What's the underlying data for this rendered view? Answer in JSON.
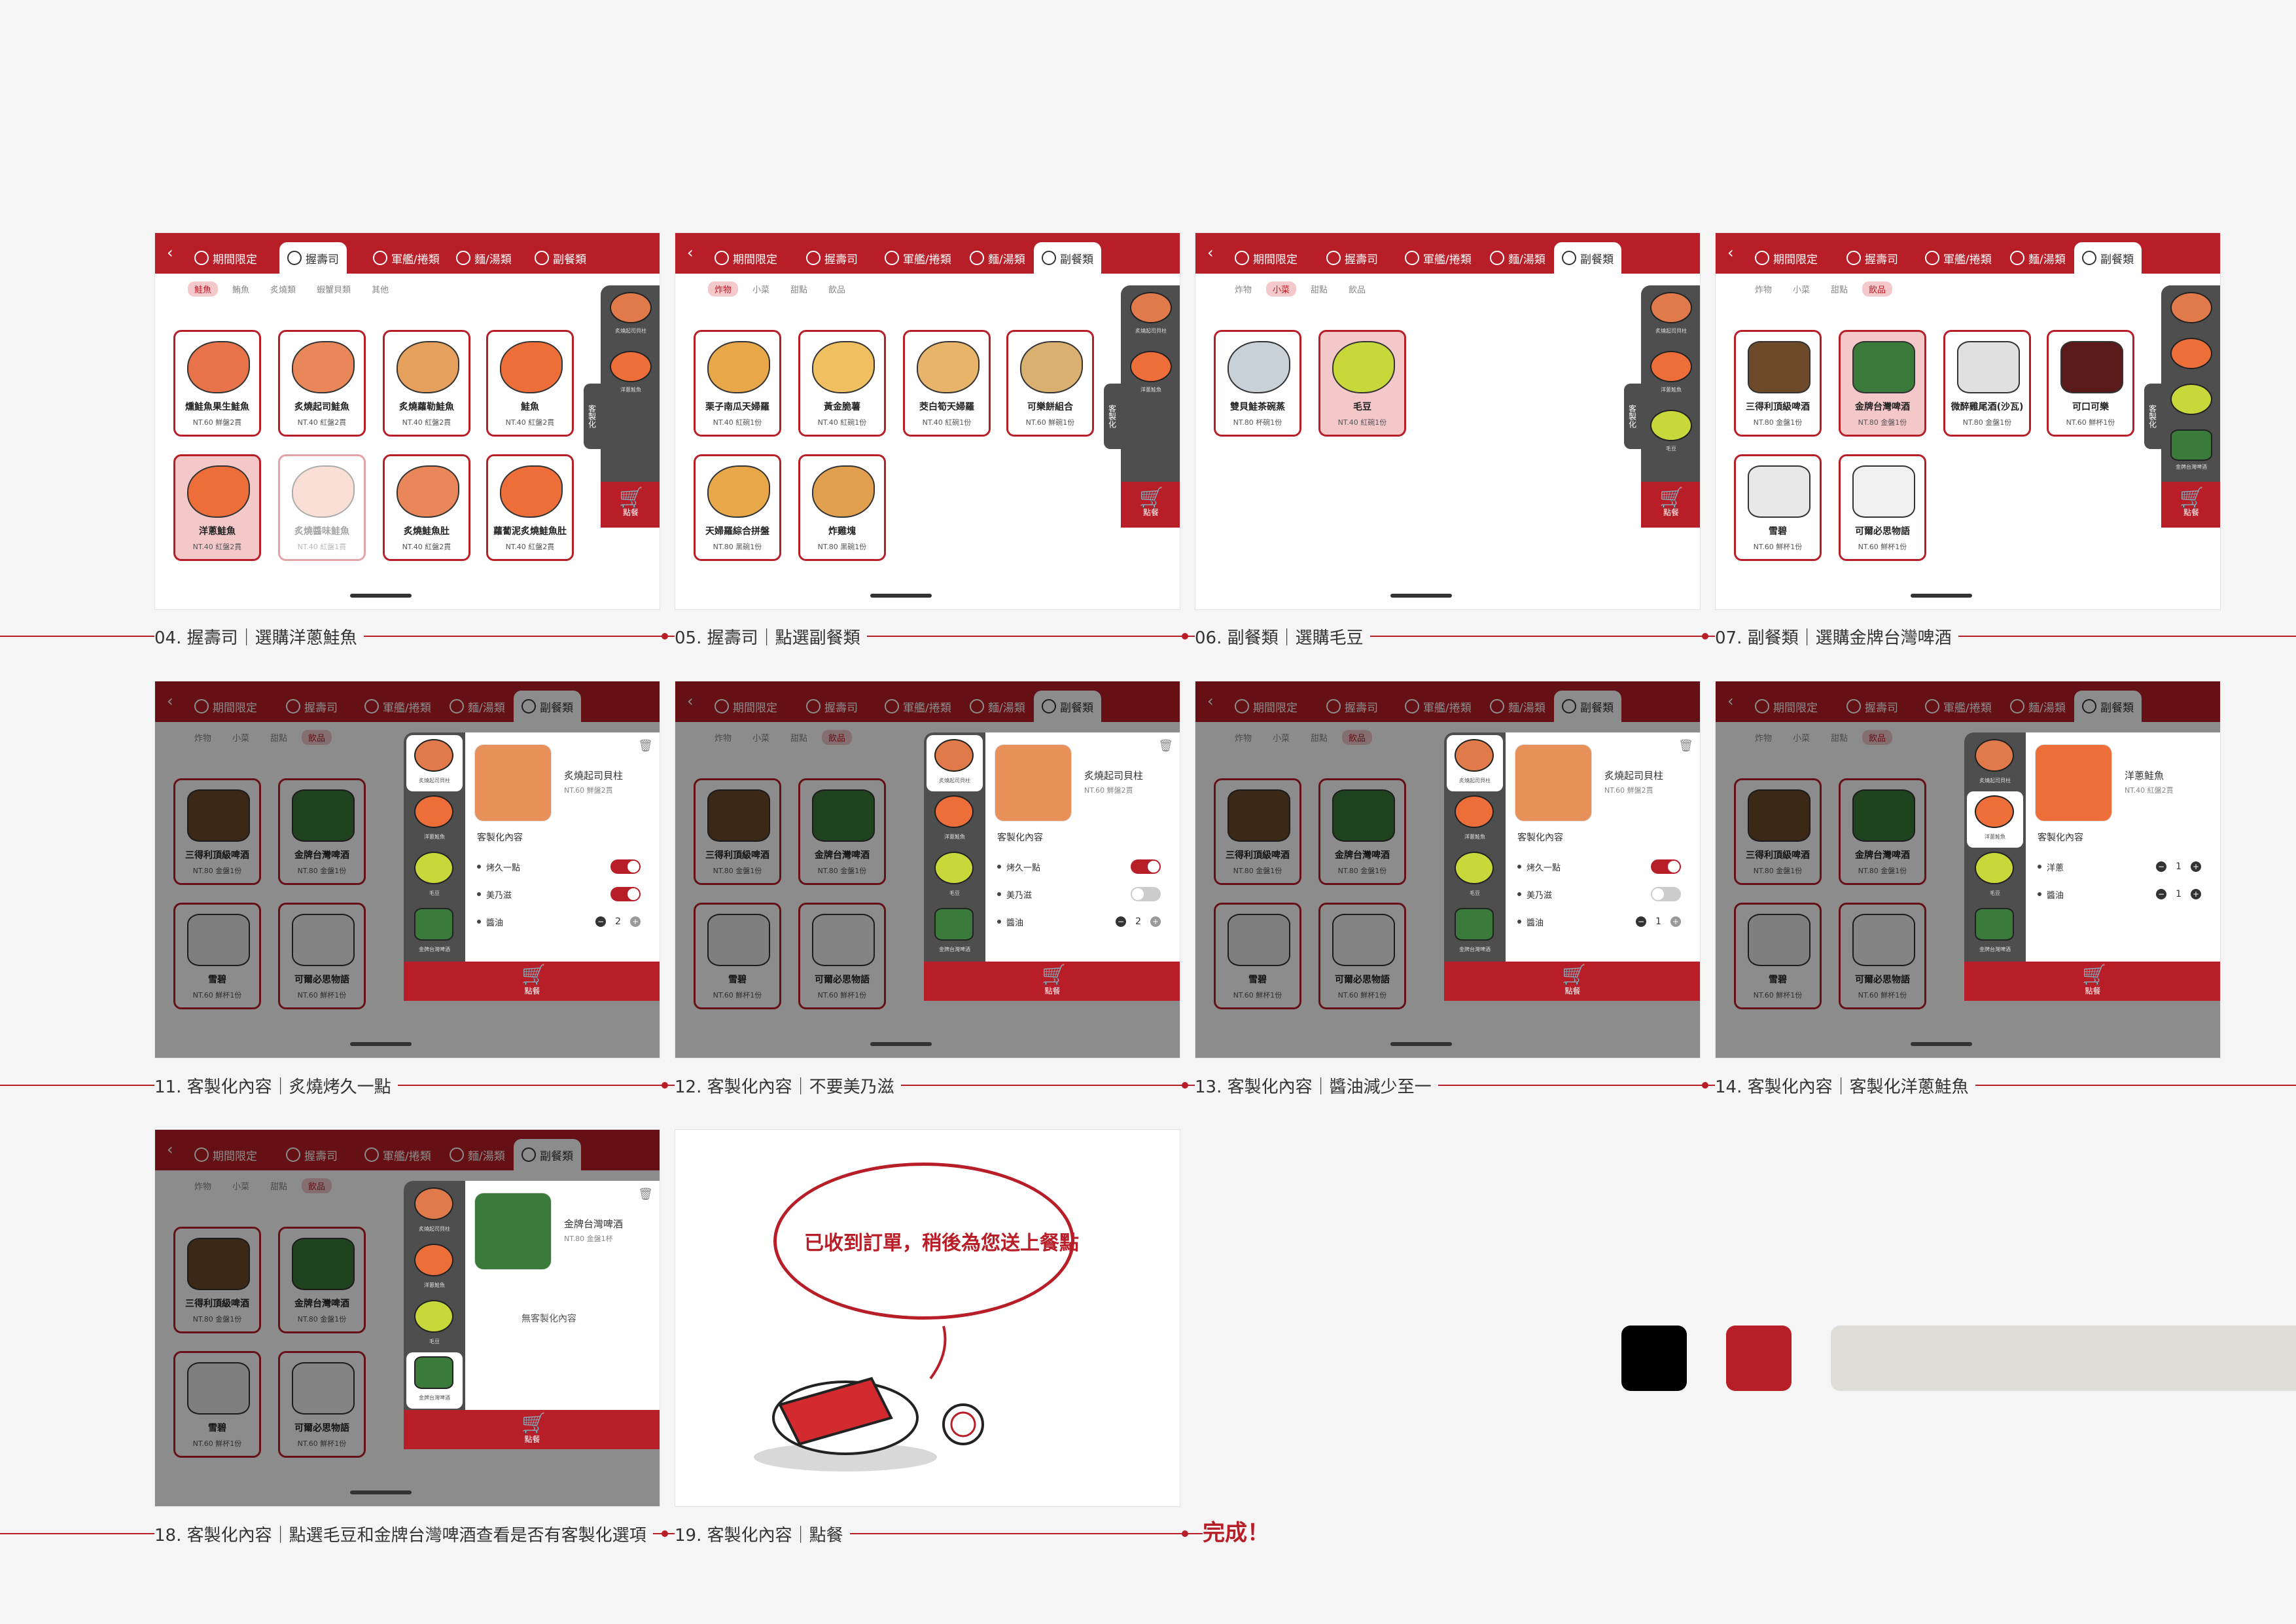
{
  "tabs": [
    "期間限定",
    "握壽司",
    "軍艦/捲類",
    "麵/湯類",
    "副餐類"
  ],
  "back_label": "‹",
  "cart_label": "點餐",
  "cart_icon": "cart-icon",
  "customize_tab": "客製化",
  "sushi_subtabs": [
    "鮭魚",
    "鮪魚",
    "炙燒類",
    "蝦蟹貝類",
    "其他"
  ],
  "side_subtabs": [
    "炸物",
    "小菜",
    "甜點",
    "飲品"
  ],
  "cart_items": {
    "scallop": "炙燒起司貝柱",
    "salmon": "洋蔥鮭魚",
    "edamame": "毛豆",
    "beer": "金牌台灣啤酒"
  },
  "sushi_items": [
    {
      "name": "燻鮭魚果生鮭魚",
      "price": "NT.60 鮮盤2貫"
    },
    {
      "name": "炙燒起司鮭魚",
      "price": "NT.40 紅盤2貫"
    },
    {
      "name": "炙燒蘿勒鮭魚",
      "price": "NT.40 紅盤2貫"
    },
    {
      "name": "鮭魚",
      "price": "NT.40 紅盤2貫"
    },
    {
      "name": "洋蔥鮭魚",
      "price": "NT.40 紅盤2貫"
    },
    {
      "name": "炙燒醬味鮭魚",
      "price": "NT.40 紅盤1貫"
    },
    {
      "name": "炙燒鮭魚肚",
      "price": "NT.40 紅盤2貫"
    },
    {
      "name": "蘿蔔泥炙燒鮭魚肚",
      "price": "NT.40 紅盤2貫"
    }
  ],
  "fried_items": [
    {
      "name": "栗子南瓜天婦羅",
      "price": "NT.40 紅碗1份"
    },
    {
      "name": "黃金脆薯",
      "price": "NT.40 紅碗1份"
    },
    {
      "name": "茭白筍天婦羅",
      "price": "NT.40 紅碗1份"
    },
    {
      "name": "可樂餅組合",
      "price": "NT.60 鮮碗1份"
    },
    {
      "name": "天婦羅綜合拼盤",
      "price": "NT.80 黑碗1份"
    },
    {
      "name": "炸雞塊",
      "price": "NT.80 黑碗1份"
    }
  ],
  "small_items": [
    {
      "name": "雙貝鮭茶碗蒸",
      "price": "NT.80 杯碗1份"
    },
    {
      "name": "毛豆",
      "price": "NT.40 紅碗1份"
    }
  ],
  "drink_items": [
    {
      "name": "三得利頂級啤酒",
      "price": "NT.80 金盤1份"
    },
    {
      "name": "金牌台灣啤酒",
      "price": "NT.80 金盤1份"
    },
    {
      "name": "微醉雞尾酒(沙瓦)",
      "price": "NT.80 金盤1份"
    },
    {
      "name": "可口可樂",
      "price": "NT.60 鮮杯1份"
    },
    {
      "name": "雪碧",
      "price": "NT.60 鮮杯1份"
    },
    {
      "name": "可爾必思物語",
      "price": "NT.60 鮮杯1份"
    }
  ],
  "popups": {
    "scallop": {
      "title": "炙燒起司貝柱",
      "price": "NT.60 鮮盤2貫"
    },
    "salmon": {
      "title": "洋蔥鮭魚",
      "price": "NT.40 紅盤2貫"
    },
    "beer": {
      "title": "金牌台灣啤酒",
      "price": "NT.80 金盤1杯"
    }
  },
  "customize_label": "客製化內容",
  "options": {
    "roast": "烤久一點",
    "mayo": "美乃滋",
    "soy": "醬油",
    "onion": "洋蔥"
  },
  "option_values": {
    "p11_soy": "2",
    "p12_soy": "2",
    "p13_soy": "1",
    "p14_onion": "1",
    "p14_soy": "1"
  },
  "no_customize": "無客製化內容",
  "trash_icon": "trash-icon",
  "order_message": "已收到訂單，稍後為您送上餐點",
  "captions": [
    "04. 握壽司｜選購洋蔥鮭魚",
    "05. 握壽司｜點選副餐類",
    "06. 副餐類｜選購毛豆",
    "07. 副餐類｜選購金牌台灣啤酒",
    "11. 客製化內容｜炙燒烤久一點",
    "12. 客製化內容｜不要美乃滋",
    "13. 客製化內容｜醬油減少至一",
    "14. 客製化內容｜客製化洋蔥鮭魚",
    "18. 客製化內容｜點選毛豆和金牌台灣啤酒查看是否有客製化選項",
    "19. 客製化內容｜點餐"
  ],
  "done_label": "完成！",
  "colors": {
    "brand_red": "#b81e27",
    "black": "#000000",
    "red_swatch": "#b81e27",
    "light_gray": "#deddd8"
  }
}
